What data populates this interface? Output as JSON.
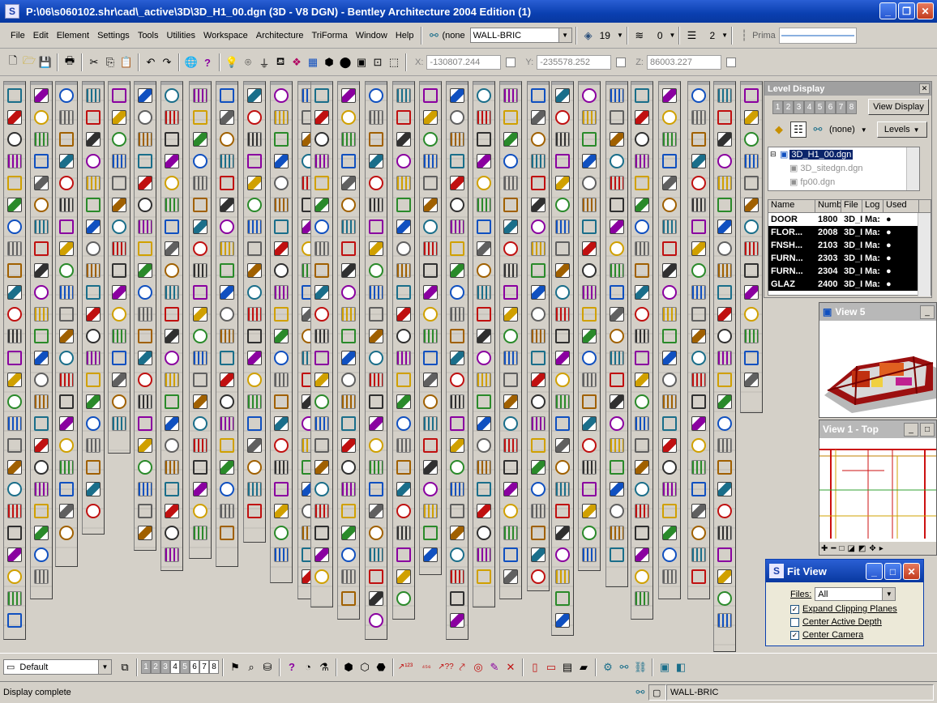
{
  "window": {
    "title": "P:\\06\\s060102.shr\\cad\\_active\\3D\\3D_H1_00.dgn (3D - V8 DGN) - Bentley Architecture 2004 Edition (1)",
    "app_icon": "S"
  },
  "menu": {
    "items": [
      "File",
      "Edit",
      "Element",
      "Settings",
      "Tools",
      "Utilities",
      "Workspace",
      "Architecture",
      "TriForma",
      "Window",
      "Help"
    ]
  },
  "attributes": {
    "level_filter": "(none",
    "level_value": "WALL-BRIC",
    "color_value": "19",
    "weight_value": "0",
    "style_value": "2",
    "primary_label": "Prima"
  },
  "coordinates": {
    "x_label": "X:",
    "x_value": "-130807.244",
    "y_label": "Y:",
    "y_value": "-235578.252",
    "z_label": "Z:",
    "z_value": "86003.227"
  },
  "level_display": {
    "title": "Level Display",
    "view_numbers": [
      "1",
      "2",
      "3",
      "4",
      "5",
      "6",
      "7",
      "8"
    ],
    "view_display_button": "View Display",
    "filter_value": "(none)",
    "levels_button": "Levels",
    "tree": [
      {
        "label": "3D_H1_00.dgn"
      },
      {
        "label": "3D_sitedgn.dgn"
      },
      {
        "label": "fp00.dgn"
      }
    ],
    "columns": [
      "Name",
      "Numb",
      "File",
      "Log",
      "Used"
    ],
    "rows": [
      {
        "name": "DOOR",
        "number": "1800",
        "file": "3D_I",
        "log": "Ma:",
        "used": "●"
      },
      {
        "name": "FLOR...",
        "number": "2008",
        "file": "3D_I",
        "log": "Ma:",
        "used": "●"
      },
      {
        "name": "FNSH...",
        "number": "2103",
        "file": "3D_I",
        "log": "Ma:",
        "used": "●"
      },
      {
        "name": "FURN...",
        "number": "2303",
        "file": "3D_I",
        "log": "Ma:",
        "used": "●"
      },
      {
        "name": "FURN...",
        "number": "2304",
        "file": "3D_I",
        "log": "Ma:",
        "used": "●"
      },
      {
        "name": "GLAZ",
        "number": "2400",
        "file": "3D_I",
        "log": "Ma:",
        "used": "●"
      }
    ]
  },
  "views": {
    "view5_title": "View 5",
    "view1_title": "View 1 - Top"
  },
  "fit_view": {
    "title": "Fit View",
    "files_label": "Files:",
    "files_value": "All",
    "options": [
      {
        "label": "Expand Clipping Planes",
        "checked": true
      },
      {
        "label": "Center Active Depth",
        "checked": false
      },
      {
        "label": "Center Camera",
        "checked": true
      }
    ]
  },
  "bottom_toolbar": {
    "view_group": "Default",
    "view_numbers": [
      "1",
      "2",
      "3",
      "4",
      "5",
      "6",
      "7",
      "8"
    ]
  },
  "status": {
    "message": "Display complete",
    "active_level": "WALL-BRIC"
  },
  "colors": {
    "titlebar": "#0a3fb0",
    "selection": "#0a246a",
    "window_bg": "#d4d0c8"
  }
}
